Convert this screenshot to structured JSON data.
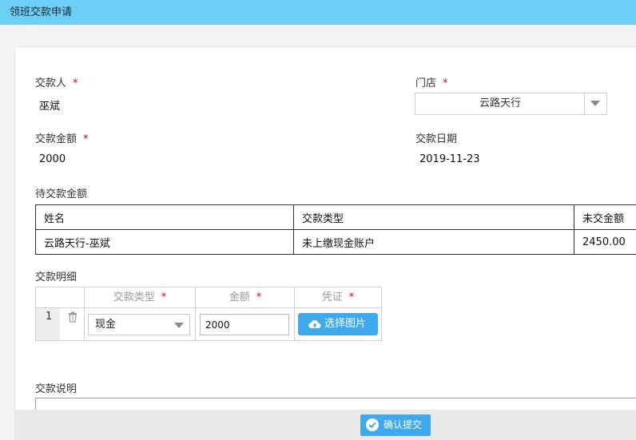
{
  "window": {
    "title": "领班交款申请"
  },
  "form": {
    "payer_label": "交款人",
    "payer_value": "巫斌",
    "store_label": "门店",
    "store_value": "云路天行",
    "amount_label": "交款金额",
    "amount_value": "2000",
    "date_label": "交款日期",
    "date_value": "2019-11-23",
    "required_mark": "*"
  },
  "pending": {
    "label": "待交款金额",
    "columns": [
      "姓名",
      "交款类型",
      "未交金额"
    ],
    "rows": [
      [
        "云路天行-巫斌",
        "未上缴现金账户",
        "2450.00"
      ]
    ]
  },
  "details": {
    "label": "交款明细",
    "columns": [
      "交款类型",
      "金额",
      "凭证"
    ],
    "rows": [
      {
        "index": "1",
        "type": "现金",
        "amount": "2000",
        "upload_label": "选择图片"
      }
    ]
  },
  "remark": {
    "label": "交款说明"
  },
  "footer": {
    "submit_label": "确认提交"
  },
  "colors": {
    "titlebar": "#6ccff7",
    "button": "#3fa9ee",
    "required": "#d9001b"
  },
  "icons": [
    "trash-icon",
    "cloud-upload-icon",
    "check-circle-icon",
    "chevron-down-icon"
  ]
}
